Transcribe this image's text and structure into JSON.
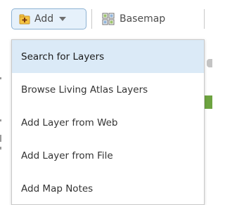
{
  "toolbar": {
    "add_label": "Add",
    "basemap_label": "Basemap"
  },
  "icons": {
    "add": "add-layer-icon",
    "add_dropdown": "chevron-down-icon",
    "basemap": "basemap-grid-icon"
  },
  "colors": {
    "accent": "#e6f1fb",
    "accent_border": "#8db2d3",
    "highlight": "#dbeaf7",
    "green": "#6da340"
  },
  "menu": {
    "items": [
      {
        "label": "Search for Layers",
        "active": true
      },
      {
        "label": "Browse Living Atlas Layers"
      },
      {
        "label": "Add Layer from Web"
      },
      {
        "label": "Add Layer from File"
      },
      {
        "label": "Add Map Notes"
      }
    ]
  }
}
